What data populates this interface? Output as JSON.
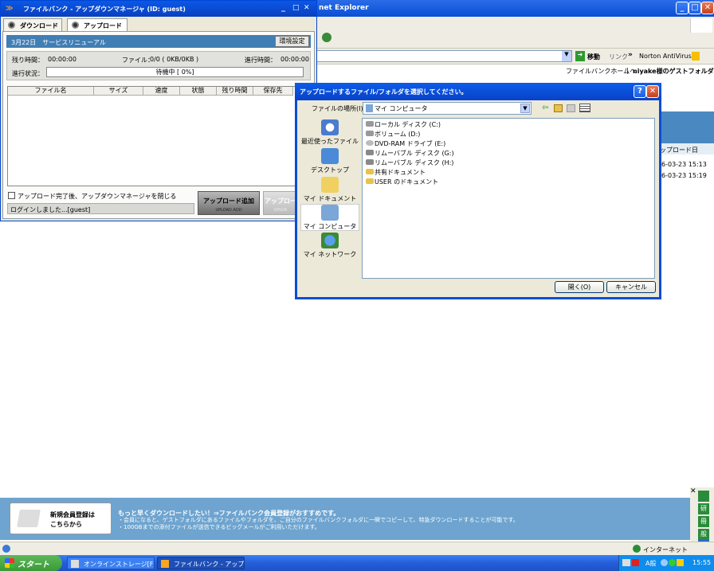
{
  "ie": {
    "title": "net Explorer",
    "go_label": "移動",
    "links_label": "リンク",
    "chevron": "»",
    "norton": "Norton AntiVirus",
    "nav_home": "ファイルバンクホームへ",
    "nav_sep": "|",
    "nav_user": "niyake様のゲストフォルダ",
    "col_header": "ップロード日",
    "dates": [
      "6-03-23 15:13",
      "6-03-23 15:19"
    ],
    "status_zone": "インターネット"
  },
  "banner": {
    "btn_line1": "新規会員登録は",
    "btn_line2": "こちらから",
    "line1": "もっと早くダウンロードしたい！⇒ファイルバンク会員登録がおすすめです。",
    "line2": "・会員になると、ゲストフォルダにあるファイルやフォルダを、ご自分のファイルバンクフォルダに一瞬でコピーして、特急ダウンロードすることが可能です。",
    "line3": "・100GBまでの添付ファイルが送信できるビッグメールがご利用いただけます。"
  },
  "side_icons": [
    "研",
    "冊",
    "般",
    "ジ"
  ],
  "taskbar": {
    "start": "スタート",
    "tasks": [
      "オンラインストレージ[FIL...",
      "ファイルバンク - アップダ..."
    ],
    "clock": "15:55",
    "ime": "A般"
  },
  "filebank": {
    "title": "ファイルバンク - アップダウンマネージャ (ID: guest)",
    "tabs": [
      "ダウンロード",
      "アップロード"
    ],
    "notice": "3月22日　サービスリニューアル",
    "settings": "環境設定",
    "remain_label": "残り時間：",
    "remain_value": "00:00:00",
    "file_label": "ファイル：",
    "file_value": "0/0 ( 0KB/0KB )",
    "elapsed_label": "進行時間：",
    "elapsed_value": "00:00:00",
    "progress_label": "進行状況：",
    "progress_text": "待機中 [ 0%]",
    "progress_percent": 0,
    "columns": [
      "ファイル名",
      "サイズ",
      "速度",
      "状態",
      "残り時間",
      "保存先"
    ],
    "close_check": "アップロード完了後、アップダウンマネージャを閉じる",
    "login_status": "ログインしました...[guest]",
    "upload_add": "アップロード追加",
    "upload_add_sub": "UPLOAD ADD",
    "upload_start": "アップロー",
    "upload_start_sub": "UPLOA"
  },
  "dialog": {
    "title": "アップロードするファイル/フォルダを選択してください。",
    "help": "?",
    "close": "✕",
    "look_in_label": "ファイルの場所(I):",
    "look_in_value": "マイ コンピュータ",
    "places": [
      "最近使ったファイル",
      "デスクトップ",
      "マイ ドキュメント",
      "マイ コンピュータ",
      "マイ ネットワーク"
    ],
    "files": [
      "ローカル ディスク (C:)",
      "ボリューム (D:)",
      "DVD-RAM ドライブ (E:)",
      "リムーバブル ディスク (G:)",
      "リムーバブル ディスク (H:)",
      "共有ドキュメント",
      "USER のドキュメント"
    ],
    "open_btn": "開く(O)",
    "cancel_btn": "キャンセル"
  },
  "colors": {
    "xp_blue": "#0a4fd4",
    "notice_blue": "#417eb4",
    "banner_blue": "#6ea4cf",
    "start_green": "#3a9a37"
  }
}
